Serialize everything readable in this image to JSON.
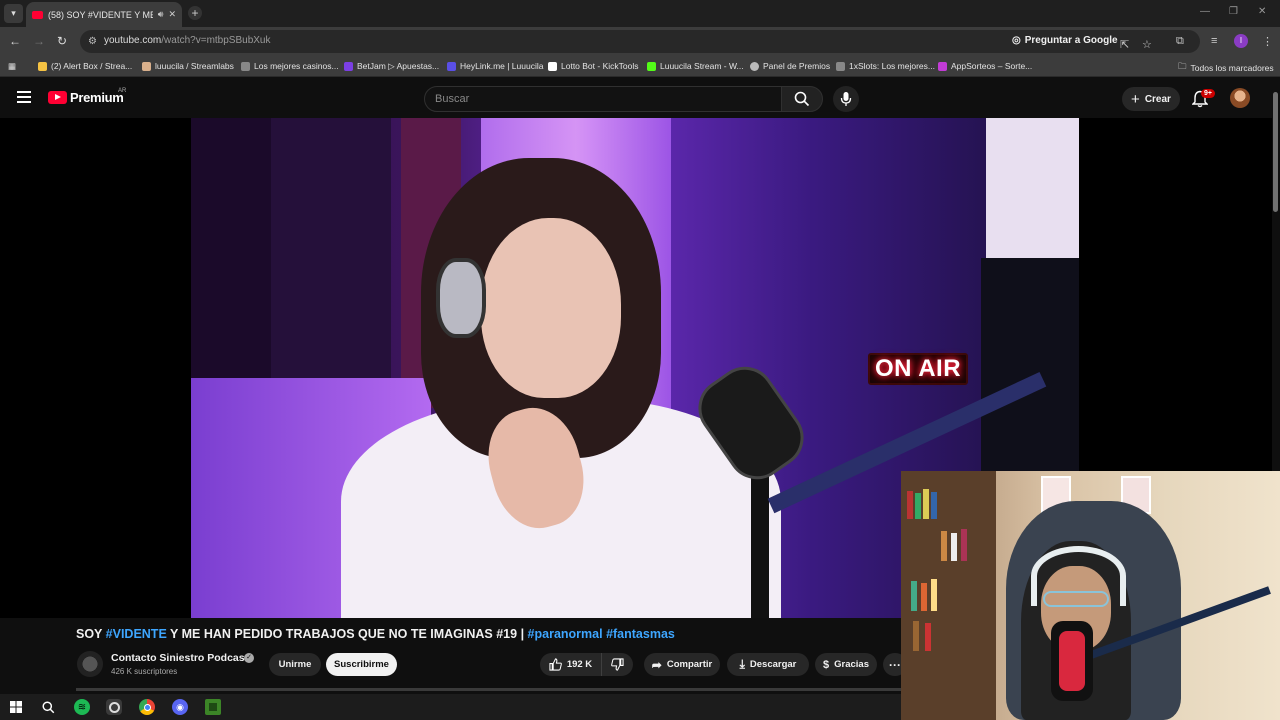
{
  "browser": {
    "tab_title": "(58) SOY #VIDENTE Y ME H",
    "url_host": "youtube.com",
    "url_path": "/watch?v=mtbpSBubXuk",
    "ask_google": "Preguntar a Google",
    "new_tab": "+"
  },
  "bookmarks": [
    {
      "label": "(2) Alert Box / Strea...",
      "color": "#f6c343"
    },
    {
      "label": "luuucila / Streamlabs",
      "color": "#d9b08c"
    },
    {
      "label": "Los mejores casinos...",
      "color": "#888888"
    },
    {
      "label": "BetJam ▷ Apuestas...",
      "color": "#7b3fe4"
    },
    {
      "label": "HeyLink.me | Luuucila",
      "color": "#5a4fe6"
    },
    {
      "label": "Lotto Bot - KickTools",
      "color": "#ffffff"
    },
    {
      "label": "Luuucila Stream - W...",
      "color": "#53fc18"
    },
    {
      "label": "Panel de Premios",
      "color": "#bbbbbb"
    },
    {
      "label": "1xSlots: Los mejores...",
      "color": "#888888"
    },
    {
      "label": "AppSorteos – Sorte...",
      "color": "#c23bd6"
    }
  ],
  "all_bookmarks": "Todos los marcadores",
  "youtube": {
    "logo_text": "Premium",
    "region": "AR",
    "search_placeholder": "Buscar",
    "create_label": "Crear",
    "notif_badge": "9+"
  },
  "video": {
    "overlay_sign": "ON AIR",
    "title_parts": [
      {
        "text": "SOY ",
        "tag": false
      },
      {
        "text": "#VIDENTE",
        "tag": true
      },
      {
        "text": " Y ME HAN PEDIDO TRABAJOS QUE NO TE IMAGINAS #19 | ",
        "tag": false
      },
      {
        "text": "#paranormal",
        "tag": true
      },
      {
        "text": " ",
        "tag": false
      },
      {
        "text": "#fantasmas",
        "tag": true
      }
    ],
    "channel_name": "Contacto Siniestro Podcast",
    "subscribers": "426 K suscriptores",
    "join_label": "Unirme",
    "subscribe_label": "Suscribirme",
    "likes": "192 K",
    "share_label": "Compartir",
    "download_label": "Descargar",
    "thanks_label": "Gracias",
    "more_label": "···"
  },
  "colors": {
    "youtube_red": "#ff0033",
    "link_blue": "#3ea6ff",
    "background": "#0f0f0f"
  }
}
